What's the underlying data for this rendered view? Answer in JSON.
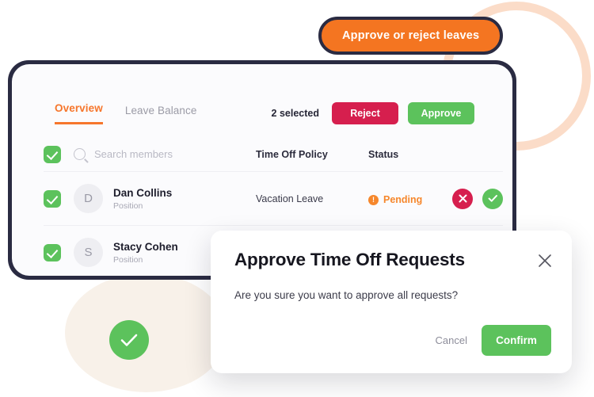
{
  "callout": {
    "label": "Approve or reject leaves"
  },
  "card": {
    "tabs": [
      {
        "label": "Overview",
        "active": true
      },
      {
        "label": "Leave Balance",
        "active": false
      }
    ],
    "selection": {
      "count_label": "2 selected",
      "reject_label": "Reject",
      "approve_label": "Approve"
    },
    "table": {
      "headers": {
        "search_placeholder": "Search members",
        "policy": "Time Off Policy",
        "status": "Status"
      },
      "rows": [
        {
          "checked": true,
          "avatar_initial": "D",
          "name": "Dan Collins",
          "position": "Position",
          "policy": "Vacation Leave",
          "status": "Pending",
          "status_icon": "warning-icon"
        },
        {
          "checked": true,
          "avatar_initial": "S",
          "name": "Stacy Cohen",
          "position": "Position",
          "policy": "",
          "status": "",
          "status_icon": ""
        }
      ]
    }
  },
  "modal": {
    "title": "Approve Time Off Requests",
    "body": "Are you sure you want to approve all requests?",
    "cancel_label": "Cancel",
    "confirm_label": "Confirm",
    "close_icon": "close-icon"
  },
  "badge": {
    "icon": "check-icon"
  },
  "colors": {
    "orange": "#f47521",
    "tab_active": "#f6762c",
    "green": "#5cc25c",
    "crimson": "#d61f4e",
    "pending": "#f6872c",
    "frame_dark": "#2a2b42",
    "ring_peach": "#fbdcc8",
    "blob_cream": "#f8f1e9"
  }
}
